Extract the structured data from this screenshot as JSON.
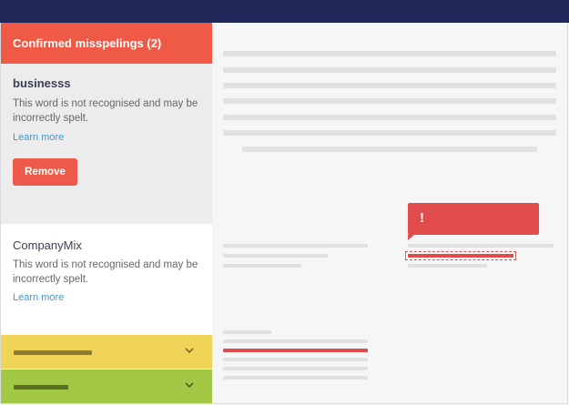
{
  "sidebar": {
    "header": "Confirmed misspelings (2)",
    "cards": [
      {
        "word": "businesss",
        "message": "This word is not recognised and may be incorrectly spelt.",
        "learn_more": "Learn more",
        "remove_label": "Remove"
      },
      {
        "word": "CompanyMix",
        "message": "This word is not recognised and may be incorrectly spelt.",
        "learn_more": "Learn more"
      }
    ]
  },
  "callout": {
    "icon": "!"
  },
  "icons": [
    "chevron-down-icon",
    "exclamation-icon"
  ],
  "colors": {
    "topbar": "#1f2859",
    "header": "#ef5a47",
    "error": "#e24b4b",
    "accordion_yellow": "#efd458",
    "accordion_green": "#a3c845",
    "link": "#3d9ad8"
  }
}
